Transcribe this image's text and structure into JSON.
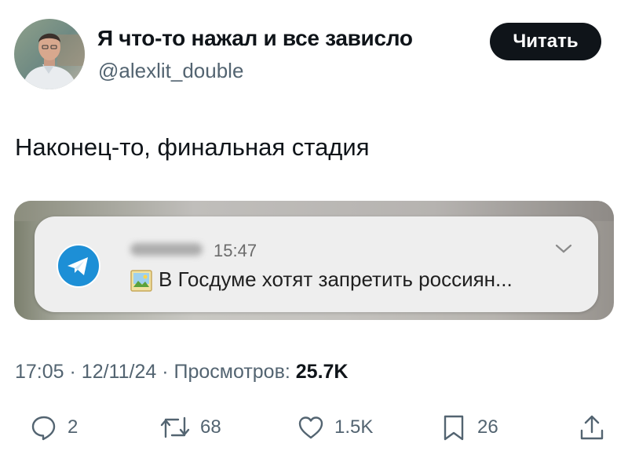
{
  "author": {
    "name": "Я что-то нажал и все зависло",
    "handle": "@alexlit_double",
    "avatar_icon": "profile-photo"
  },
  "follow_button": {
    "label": "Читать"
  },
  "tweet": {
    "text": "Наконец-то, финальная стадия"
  },
  "media": {
    "notification": {
      "app_icon": "telegram-icon",
      "sender_blurred": true,
      "time": "15:47",
      "message": "В Госдуме хотят запретить россиян..."
    }
  },
  "meta": {
    "time": "17:05",
    "date": "12/11/24",
    "views_label": "Просмотров:",
    "views": "25.7K",
    "separator": "·"
  },
  "actions": {
    "replies": "2",
    "retweets": "68",
    "likes": "1.5K",
    "bookmarks": "26"
  },
  "colors": {
    "text": "#0f1419",
    "secondary": "#536471",
    "telegram": "#2AABEE",
    "button_bg": "#0f1419"
  }
}
